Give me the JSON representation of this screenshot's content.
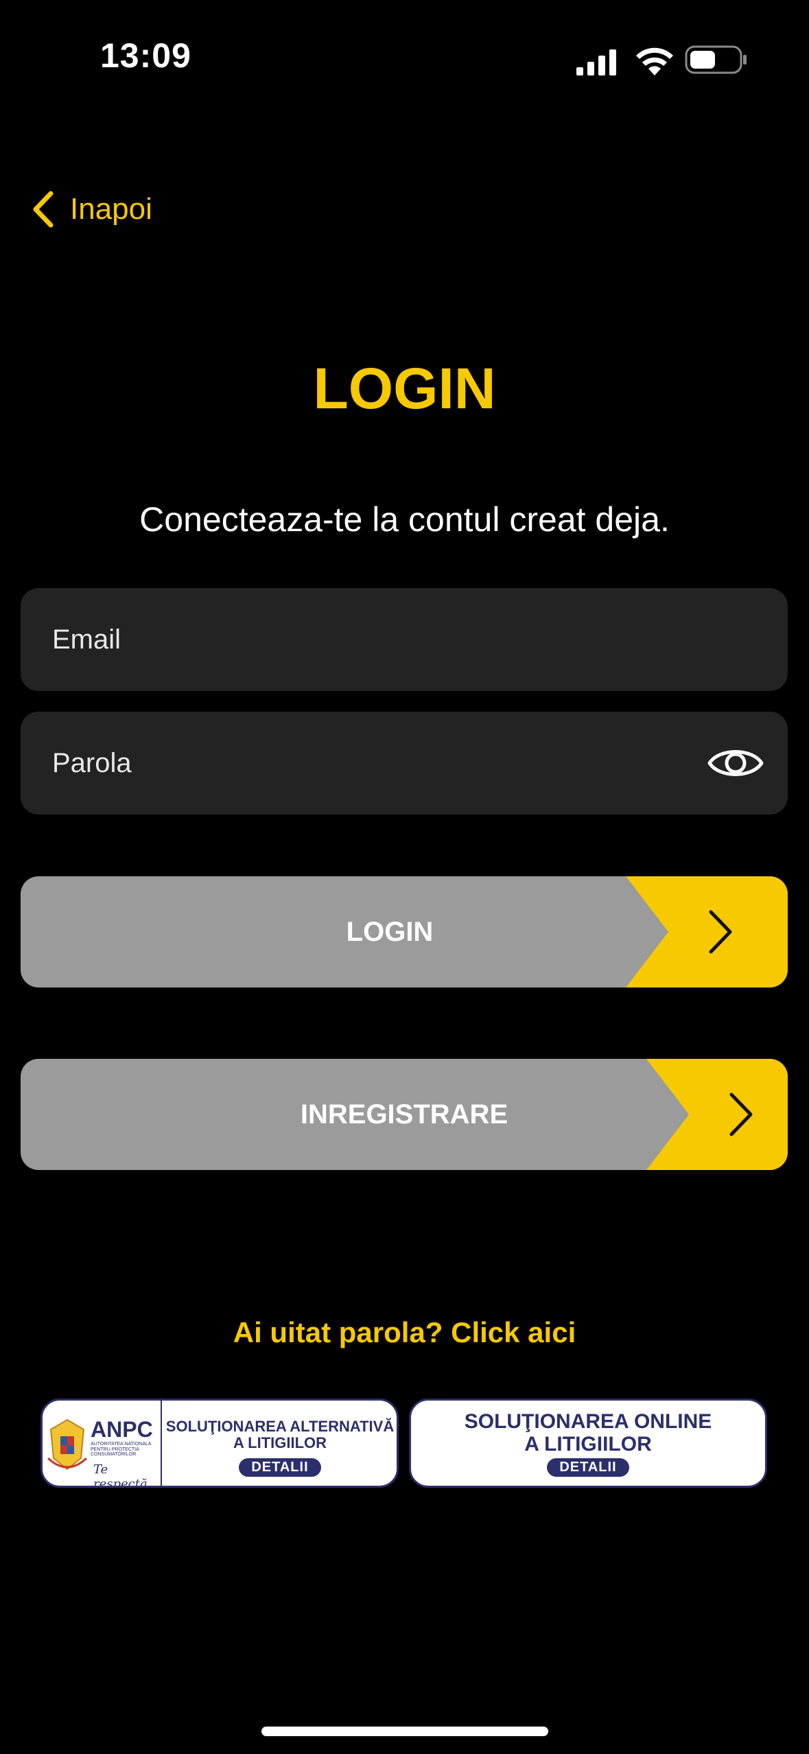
{
  "status_bar": {
    "time": "13:09"
  },
  "nav": {
    "back_label": "Inapoi"
  },
  "page": {
    "title": "LOGIN",
    "subtitle": "Conecteaza-te la contul creat deja."
  },
  "form": {
    "email_placeholder": "Email",
    "email_value": "",
    "password_placeholder": "Parola",
    "password_value": ""
  },
  "buttons": {
    "login_label": "LOGIN",
    "register_label": "INREGISTRARE"
  },
  "forgot_password": "Ai uitat parola? Click aici",
  "banners": {
    "sal": {
      "logo_text": "ANPC",
      "logo_small": "AUTORITATEA NATIONALA PENTRU PROTECTIA CONSUMATORILOR",
      "logo_tagline": "Te respectă",
      "line1": "SOLUŢIONAREA ALTERNATIVĂ",
      "line2": "A LITIGIILOR",
      "button": "DETALII"
    },
    "sol": {
      "line1": "SOLUŢIONAREA ONLINE",
      "line2": "A LITIGIILOR",
      "button": "DETALII"
    }
  },
  "colors": {
    "accent": "#f7c900",
    "background": "#000000",
    "field_bg": "#232323",
    "button_gray": "#9b9b9b",
    "banner_navy": "#2c2f6b"
  },
  "icons": {
    "back": "chevron-left-icon",
    "eye": "eye-icon",
    "cta_arrow": "chevron-right-icon"
  }
}
